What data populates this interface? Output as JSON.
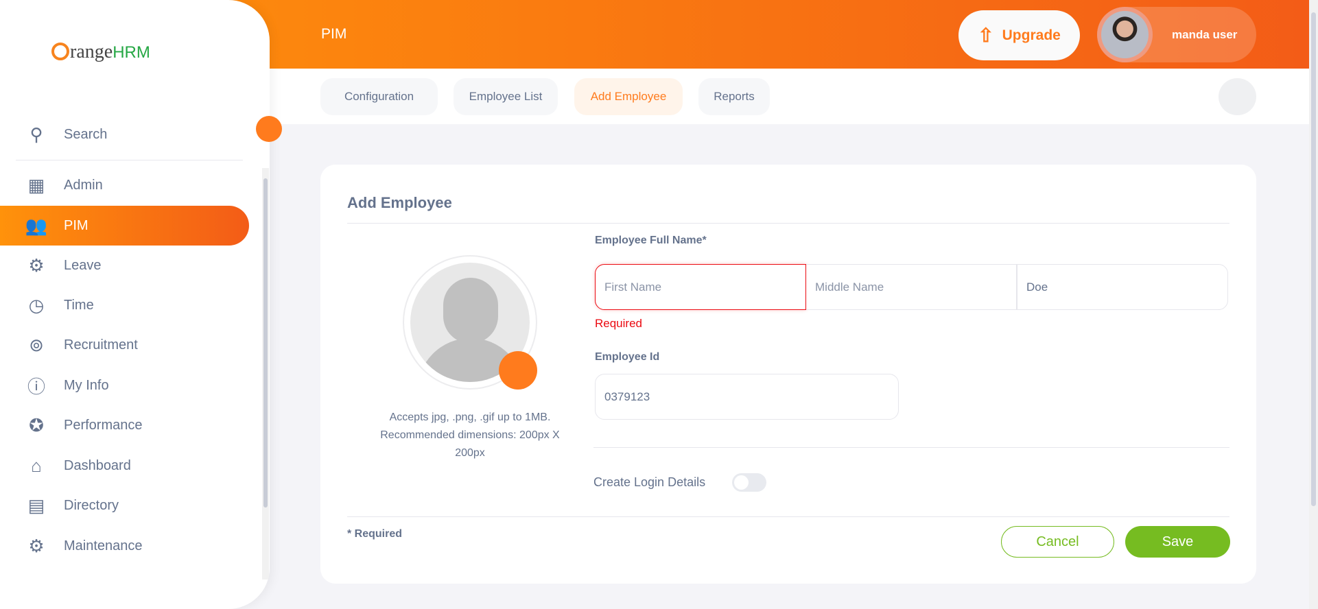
{
  "header": {
    "title": "PIM",
    "upgrade_label": "Upgrade",
    "user_name": "manda user"
  },
  "brand": {
    "logo_text_1": "range",
    "logo_text_2": "HRM",
    "colors": {
      "accent": "#ff7b1d",
      "success": "#76bc21",
      "error": "#eb0910"
    }
  },
  "tabs": [
    {
      "label": "Configuration"
    },
    {
      "label": "Employee List"
    },
    {
      "label": "Add Employee",
      "active": true
    },
    {
      "label": "Reports"
    }
  ],
  "sidebar": {
    "items": [
      {
        "label": "Search",
        "icon": "search-icon"
      },
      {
        "label": "Admin",
        "icon": "admin-icon"
      },
      {
        "label": "PIM",
        "icon": "pim-icon",
        "active": true
      },
      {
        "label": "Leave",
        "icon": "leave-icon"
      },
      {
        "label": "Time",
        "icon": "time-icon"
      },
      {
        "label": "Recruitment",
        "icon": "recruitment-icon"
      },
      {
        "label": "My Info",
        "icon": "my-info-icon"
      },
      {
        "label": "Performance",
        "icon": "performance-icon"
      },
      {
        "label": "Dashboard",
        "icon": "dashboard-icon"
      },
      {
        "label": "Directory",
        "icon": "directory-icon"
      },
      {
        "label": "Maintenance",
        "icon": "maintenance-icon"
      }
    ]
  },
  "form": {
    "title": "Add Employee",
    "photo_caption_1": "Accepts jpg, .png, .gif up to 1MB.",
    "photo_caption_2": "Recommended dimensions: 200px X",
    "photo_caption_3": "200px",
    "full_name_label": "Employee Full Name*",
    "first_name_placeholder": "First Name",
    "middle_name_placeholder": "Middle Name",
    "last_name_value": "Doe",
    "required_error": "Required",
    "employee_id_label": "Employee Id",
    "employee_id_value": "0379123",
    "create_login_label": "Create Login Details",
    "create_login_enabled": false,
    "required_note": "* Required",
    "cancel_label": "Cancel",
    "save_label": "Save"
  }
}
